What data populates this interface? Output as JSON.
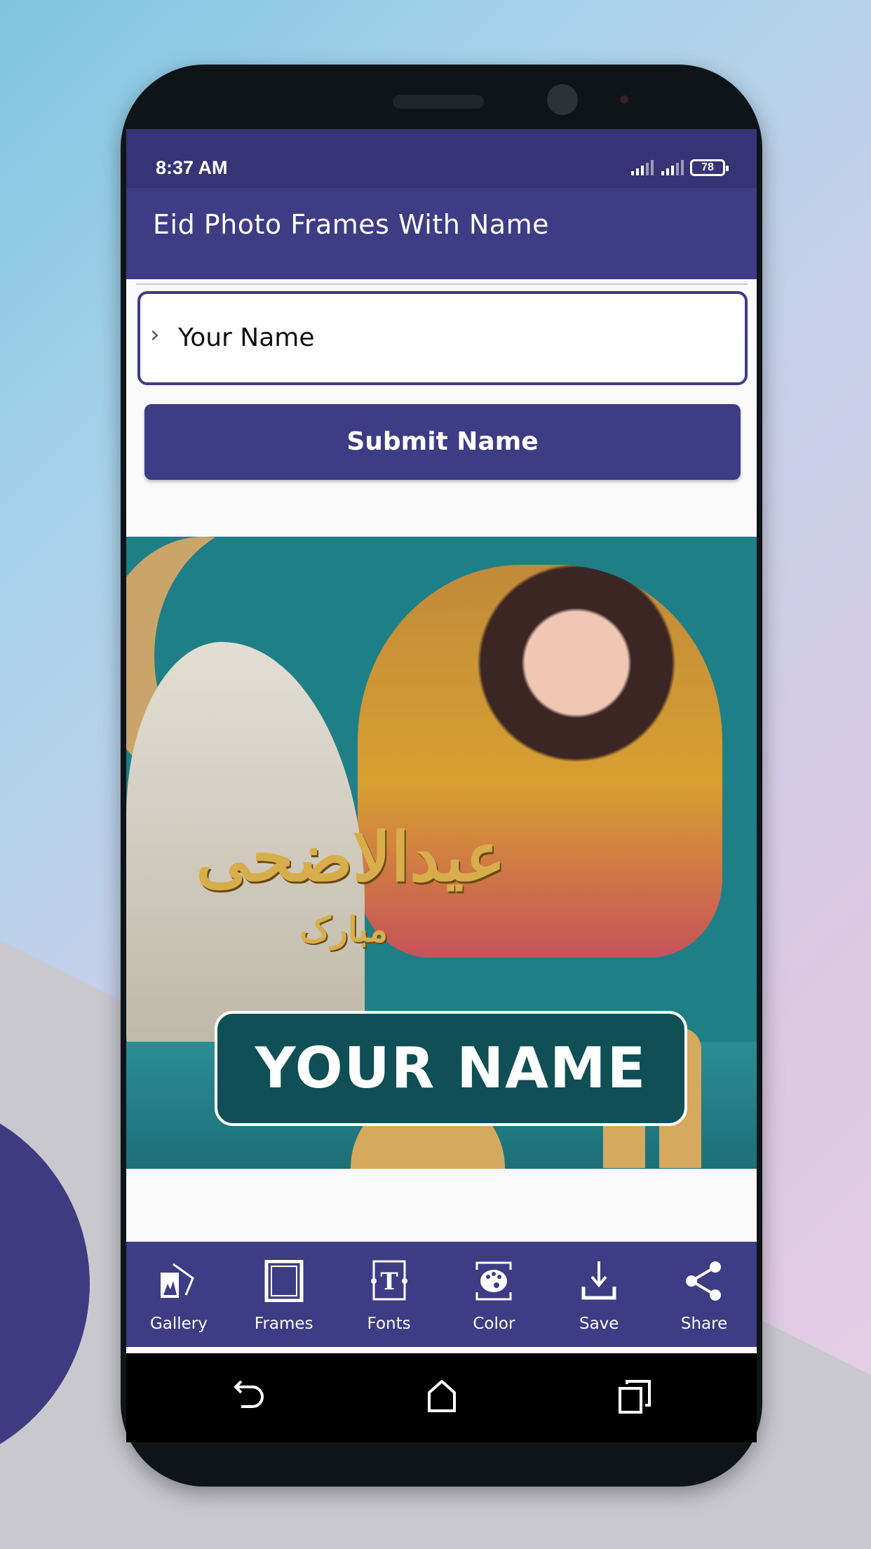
{
  "status_bar": {
    "time": "8:37 AM",
    "battery": "78"
  },
  "app_bar": {
    "title": "Eid Photo Frames With Name"
  },
  "name_input": {
    "value": "Your Name"
  },
  "submit_button": {
    "label": "Submit Name"
  },
  "frame_preview": {
    "name_text": "YOUR NAME",
    "artwork_lettering": "عیدالاضحی",
    "artwork_lettering_2": "مبارک"
  },
  "toolbar": {
    "items": [
      {
        "label": "Gallery",
        "icon": "gallery-icon"
      },
      {
        "label": "Frames",
        "icon": "frame-icon"
      },
      {
        "label": "Fonts",
        "icon": "font-icon"
      },
      {
        "label": "Color",
        "icon": "palette-icon"
      },
      {
        "label": "Save",
        "icon": "download-icon"
      },
      {
        "label": "Share",
        "icon": "share-icon"
      }
    ]
  },
  "colors": {
    "primary": "#3e3c84",
    "status_bar": "#363474",
    "frame_teal": "#1f7f86",
    "gold": "#d8ae4c"
  }
}
